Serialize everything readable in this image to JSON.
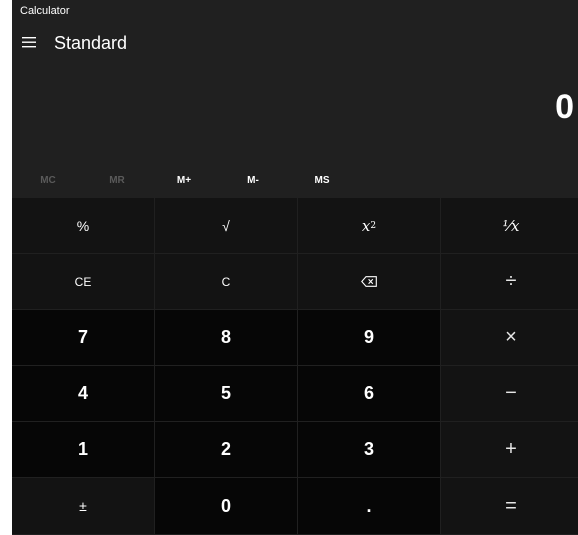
{
  "window": {
    "title": "Calculator"
  },
  "header": {
    "mode_title": "Standard"
  },
  "display": {
    "value": "0"
  },
  "memory": {
    "mc": "MC",
    "mr": "MR",
    "m_plus": "M+",
    "m_minus": "M-",
    "ms": "MS"
  },
  "keys": {
    "percent": "%",
    "sqrt": "√",
    "square_base": "x",
    "square_exp": "2",
    "reciprocal": "⅟x",
    "ce": "CE",
    "c": "C",
    "backspace": "⌫",
    "divide": "÷",
    "n7": "7",
    "n8": "8",
    "n9": "9",
    "multiply": "×",
    "n4": "4",
    "n5": "5",
    "n6": "6",
    "minus": "−",
    "n1": "1",
    "n2": "2",
    "n3": "3",
    "plus": "+",
    "negate": "±",
    "n0": "0",
    "decimal": ".",
    "equals": "="
  },
  "colors": {
    "window_bg": "#202020",
    "fn_key_bg": "#131313",
    "num_key_bg": "#060606",
    "text": "#ffffff",
    "disabled_text": "#5a5a5a"
  },
  "icons": {
    "menu": "hamburger-icon",
    "backspace": "backspace-icon"
  }
}
